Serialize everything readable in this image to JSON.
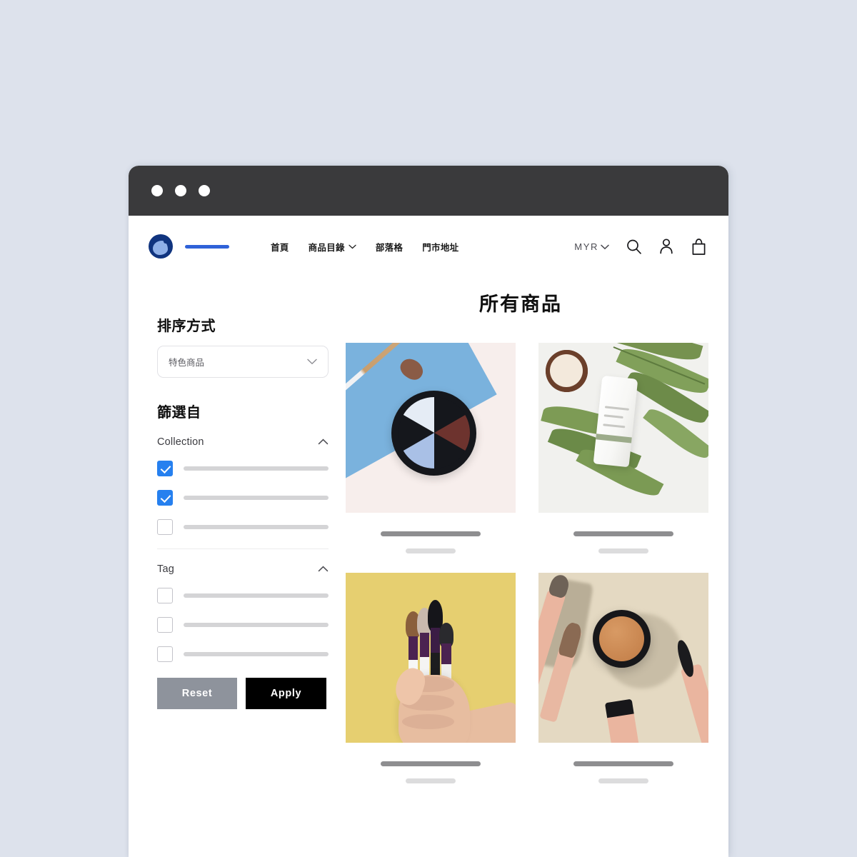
{
  "browser": {
    "traffic_lights": [
      "dot-1",
      "dot-2",
      "dot-3"
    ]
  },
  "header": {
    "logo_icon": "brand-logo-icon",
    "brand_name_placeholder": "",
    "nav": [
      {
        "label": "首頁",
        "has_dropdown": false
      },
      {
        "label": "商品目錄",
        "has_dropdown": true
      },
      {
        "label": "部落格",
        "has_dropdown": false
      },
      {
        "label": "門市地址",
        "has_dropdown": false
      }
    ],
    "currency": {
      "label": "MYR",
      "icon": "chevron-down-icon"
    },
    "actions": [
      {
        "name": "search-icon"
      },
      {
        "name": "account-icon"
      },
      {
        "name": "cart-icon"
      }
    ]
  },
  "sidebar": {
    "sort": {
      "heading": "排序方式",
      "selected_value": "特色商品",
      "chevron": "chevron-down-icon"
    },
    "filter": {
      "heading": "篩選自",
      "groups": [
        {
          "title": "Collection",
          "chevron": "chevron-up-icon",
          "options": [
            {
              "checked": true,
              "label_placeholder": ""
            },
            {
              "checked": true,
              "label_placeholder": ""
            },
            {
              "checked": false,
              "label_placeholder": ""
            }
          ]
        },
        {
          "title": "Tag",
          "chevron": "chevron-up-icon",
          "options": [
            {
              "checked": false,
              "label_placeholder": ""
            },
            {
              "checked": false,
              "label_placeholder": ""
            },
            {
              "checked": false,
              "label_placeholder": ""
            }
          ]
        }
      ],
      "reset_label": "Reset",
      "apply_label": "Apply"
    }
  },
  "main": {
    "page_title": "所有商品",
    "products": [
      {
        "art": "art-p1",
        "name": "product-eyeshadow-palette",
        "title_placeholder": "",
        "price_placeholder": ""
      },
      {
        "art": "art-p2",
        "name": "product-skincare-bottle",
        "title_placeholder": "",
        "price_placeholder": ""
      },
      {
        "art": "art-p3",
        "name": "product-makeup-brush-set",
        "title_placeholder": "",
        "price_placeholder": ""
      },
      {
        "art": "art-p4",
        "name": "product-bronzer-compact",
        "title_placeholder": "",
        "price_placeholder": ""
      }
    ]
  },
  "colors": {
    "page_background": "#dde2ec",
    "titlebar": "#3a3a3c",
    "accent_blue": "#2680ef",
    "brand_blue": "#10347f",
    "apply_button": "#000000",
    "reset_button": "#8e939c"
  }
}
